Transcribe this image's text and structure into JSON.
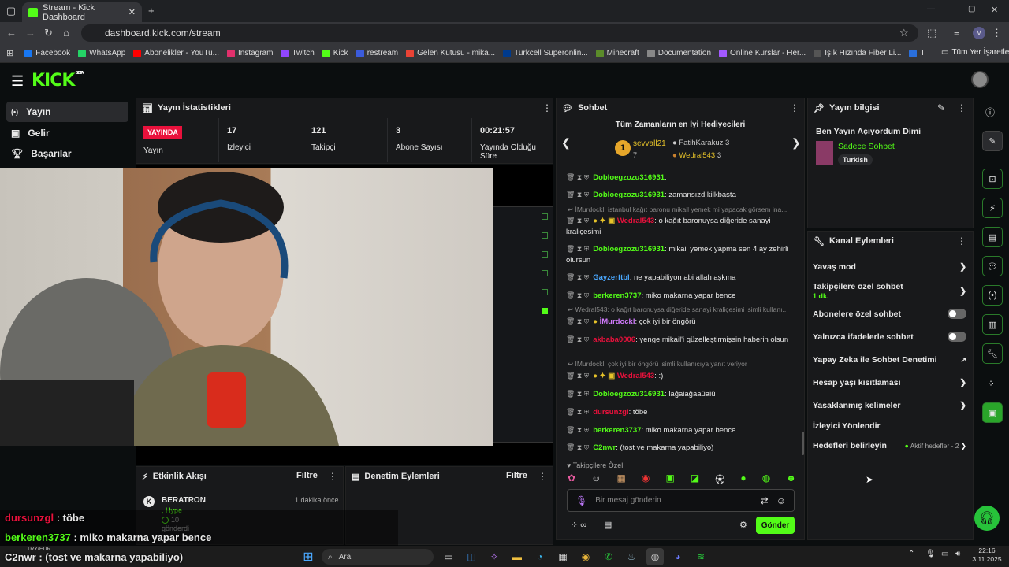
{
  "browser": {
    "tab_title": "Stream - Kick Dashboard",
    "url": "dashboard.kick.com/stream",
    "profile": "M"
  },
  "bookmarks": [
    "Facebook",
    "WhatsApp",
    "Abonelikler - YouTu...",
    "Instagram",
    "Twitch",
    "Kick",
    "restream",
    "Gelen Kutusu - mika...",
    "Turkcell Superonlin...",
    "Minecraft",
    "Documentation",
    "Online Kurslar - Her...",
    "Işık Hızında Fiber Li...",
    "T.C Sağlık Bakanlığı...",
    "Tüm Yer İşaretleri"
  ],
  "kick": {
    "logo": "KICK",
    "beta": "BETA"
  },
  "nav": [
    {
      "label": "Yayın"
    },
    {
      "label": "Gelir"
    },
    {
      "label": "Başarılar"
    }
  ],
  "stats": {
    "title": "Yayın İstatistikleri",
    "live_badge": "YAYINDA",
    "live_label": "Yayın",
    "viewers": "17",
    "viewers_label": "İzleyici",
    "followers": "121",
    "followers_label": "Takipçi",
    "subs": "3",
    "subs_label": "Abone Sayısı",
    "duration": "00:21:57",
    "duration_label": "Yayında Olduğu Süre"
  },
  "chat": {
    "title": "Sohbet",
    "gifters_title": "Tüm Zamanların en İyi Hediyecileri",
    "g1": "sevvall21",
    "g1c": "7",
    "g2": "FatihKarakuz",
    "g2c": "3",
    "g3": "Wedral543",
    "g3c": "3",
    "placeholder": "Bir mesaj gönderin",
    "send": "Gönder",
    "followers_only": "Takipçilere Özel"
  },
  "messages": [
    {
      "user": "Dobloegzozu316931",
      "text": "zamansızdıkilkbasta"
    },
    {
      "sys": "İMurdockl: istanbul kağıt baronu mikail yemek mi yapacak görsem ina..."
    },
    {
      "user": "Wedral543",
      "text": "o kağıt baronuysa diğeride sanayi kraliçesimi"
    },
    {
      "user": "Dobloegzozu316931",
      "text": "mikail yemek yapma sen 4 ay zehirli olursun"
    },
    {
      "user": "Gayzerftbl",
      "text": "ne yapabiliyon abi allah aşkına"
    },
    {
      "user": "berkeren3737",
      "text": "miko makarna yapar bence"
    },
    {
      "sys": "Wedral543: o kağıt baronuysa diğeride sanayi kraliçesimi isimli kullanı..."
    },
    {
      "user": "İMurdockl",
      "text": "çok iyi bir öngörü"
    },
    {
      "user": "akbaba0006",
      "text": "yenge mikail'i güzelleştirmişsin haberin olsun"
    },
    {
      "sys": "İMurdockl: çok iyi bir öngörü isimli kullanıcıya yanıt veriyor"
    },
    {
      "user": "Wedral543",
      "text": ":)"
    },
    {
      "user": "Dobloegzozu316931",
      "text": "lağaiağaaüaiü"
    },
    {
      "user": "dursunzgl",
      "text": "töbe"
    },
    {
      "user": "berkeren3737",
      "text": "miko makarna yapar bence"
    },
    {
      "user": "C2nwr",
      "text": "(tost ve makarna yapabiliyo)"
    }
  ],
  "stream_info": {
    "title": "Yayın bilgisi",
    "stream_title": "Ben Yayın Açıyordum Dimi",
    "category": "Sadece Sohbet",
    "language": "Turkish"
  },
  "channel_actions": {
    "title": "Kanal Eylemleri",
    "slow": "Yavaş mod",
    "followers_chat": "Takipçilere özel sohbet",
    "followers_sub": "1 dk.",
    "subs_chat": "Abonelere özel sohbet",
    "emote_chat": "Yalnızca ifadelerle sohbet",
    "ai": "Yapay Zeka ile Sohbet Denetimi",
    "age": "Hesap yaşı kısıtlaması",
    "banned": "Yasaklanmış kelimeler",
    "redirect": "İzleyici Yönlendir",
    "goals": "Hedefleri belirleyin",
    "goals_status": "Aktif hedefler - 2"
  },
  "activity": {
    "title": "Etkinlik Akışı",
    "filter": "Filtre",
    "user": "BERATRON",
    "ago": "1 dakika önce",
    "hype": ", Hype",
    "sent": "10",
    "sent_label": "gönderdi"
  },
  "mod": {
    "title": "Denetim Eylemleri",
    "filter": "Filtre"
  },
  "overlay": [
    {
      "user": "dursunzgl",
      "text": " : töbe"
    },
    {
      "user": "berkeren3737",
      "text": " : miko makarna yapar bence"
    },
    {
      "user": "C2nwr",
      "text": " : (tost ve makarna yapabiliyo)"
    }
  ],
  "taskbar": {
    "search": "Ara",
    "ticker": "TRY/EUR",
    "time": "22:16",
    "date": "3.11.2025"
  },
  "colors": {
    "accent": "#53fc18",
    "live": "#e9113c"
  }
}
